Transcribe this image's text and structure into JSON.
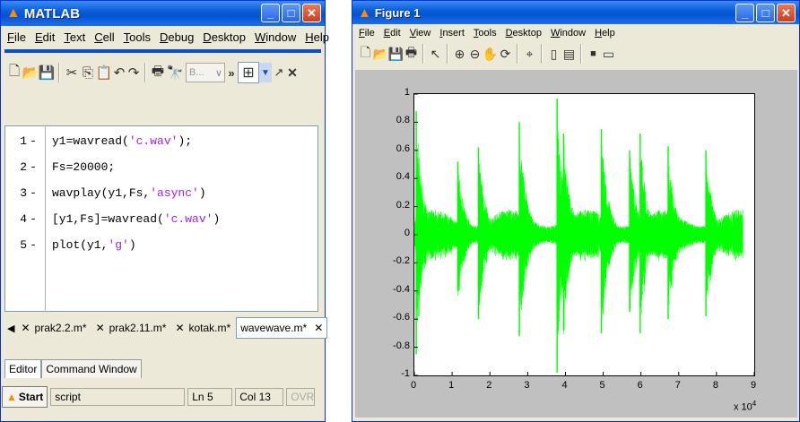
{
  "matlab": {
    "title": "MATLAB",
    "menu": [
      "File",
      "Edit",
      "Text",
      "Cell",
      "Tools",
      "Debug",
      "Desktop",
      "Window",
      "Help"
    ],
    "toolbar_combo": "B...",
    "code_lines": [
      {
        "num": "1",
        "dash": "-",
        "pre": "y1=wavread(",
        "str": "'c.wav'",
        "post": ");"
      },
      {
        "num": "2",
        "dash": "-",
        "pre": "Fs=20000;",
        "str": "",
        "post": ""
      },
      {
        "num": "3",
        "dash": "-",
        "pre": "wavplay(y1,Fs,",
        "str": "'async'",
        "post": ")"
      },
      {
        "num": "4",
        "dash": "-",
        "pre": "[y1,Fs]=wavread(",
        "str": "'c.wav'",
        "post": ")"
      },
      {
        "num": "5",
        "dash": "-",
        "pre": "plot(y1,",
        "str": "'g'",
        "post": ")"
      }
    ],
    "doc_tabs": [
      "prak2.2.m*",
      "prak2.11.m*",
      "kotak.m*",
      "wavewave.m*"
    ],
    "bottom_tabs": [
      "Editor",
      "Command Window"
    ],
    "status": {
      "start": "Start",
      "field": "script",
      "ln_label": "Ln",
      "ln": "5",
      "col_label": "Col",
      "col": "13",
      "ovr": "OVR"
    }
  },
  "figure": {
    "title": "Figure 1",
    "menu": [
      "File",
      "Edit",
      "View",
      "Insert",
      "Tools",
      "Desktop",
      "Window",
      "Help"
    ]
  },
  "chart_data": {
    "type": "line",
    "series_color": "#00ff00",
    "xlim": [
      0,
      9
    ],
    "ylim": [
      -1,
      1
    ],
    "xticks": [
      "0",
      "1",
      "2",
      "3",
      "4",
      "5",
      "6",
      "7",
      "8",
      "9"
    ],
    "yticks": [
      "1",
      "0.8",
      "0.6",
      "0.4",
      "0.2",
      "0",
      "-0.2",
      "-0.4",
      "-0.6",
      "-0.8",
      "-1"
    ],
    "x_multiplier": "x 10",
    "x_multiplier_exp": "4",
    "bursts": [
      {
        "x": 0.05,
        "peak": 0.88,
        "trough": -0.85
      },
      {
        "x": 1.15,
        "peak": 0.52,
        "trough": -0.4
      },
      {
        "x": 1.7,
        "peak": 0.62,
        "trough": -0.6
      },
      {
        "x": 2.78,
        "peak": 0.8,
        "trough": -0.72
      },
      {
        "x": 3.78,
        "peak": 0.97,
        "trough": -0.98
      },
      {
        "x": 3.95,
        "peak": 0.72,
        "trough": -0.68
      },
      {
        "x": 4.95,
        "peak": 0.75,
        "trough": -0.7
      },
      {
        "x": 5.7,
        "peak": 0.6,
        "trough": -0.55
      },
      {
        "x": 5.98,
        "peak": 0.72,
        "trough": -0.7
      },
      {
        "x": 6.72,
        "peak": 0.63,
        "trough": -0.6
      },
      {
        "x": 7.72,
        "peak": 0.6,
        "trough": -0.58
      }
    ]
  }
}
